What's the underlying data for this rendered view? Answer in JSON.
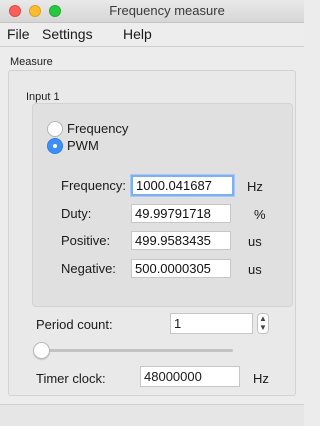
{
  "window": {
    "title": "Frequency measure"
  },
  "menu": {
    "file": "File",
    "settings": "Settings",
    "help": "Help"
  },
  "measure": {
    "group_label": "Measure",
    "input1": {
      "group_label": "Input 1",
      "radio_frequency": "Frequency",
      "radio_pwm": "PWM",
      "selected_mode": "PWM",
      "fields": {
        "frequency": {
          "label": "Frequency:",
          "value": "1000.041687",
          "unit": "Hz"
        },
        "duty": {
          "label": "Duty:",
          "value": "49.99791718",
          "unit": "%"
        },
        "positive": {
          "label": "Positive:",
          "value": "499.9583435",
          "unit": "us"
        },
        "negative": {
          "label": "Negative:",
          "value": "500.0000305",
          "unit": "us"
        }
      }
    },
    "period_count": {
      "label": "Period count:",
      "value": "1",
      "slider_level": 0
    },
    "timer_clock": {
      "label": "Timer clock:",
      "value": "48000000",
      "unit": "Hz"
    }
  },
  "colors": {
    "accent": "#3d8ef7",
    "close": "#fc5f57",
    "minimize": "#fdbc2e",
    "zoom": "#29c740"
  }
}
